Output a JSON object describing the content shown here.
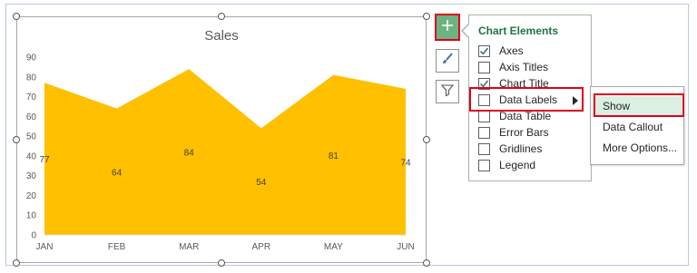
{
  "chart_data": {
    "type": "area",
    "title": "Sales",
    "categories": [
      "JAN",
      "FEB",
      "MAR",
      "APR",
      "MAY",
      "JUN"
    ],
    "values": [
      77,
      64,
      84,
      54,
      81,
      74
    ],
    "data_labels": [
      "77",
      "64",
      "84",
      "54",
      "81",
      "74"
    ],
    "ylim": [
      0,
      90
    ],
    "y_ticks": [
      "0",
      "10",
      "20",
      "30",
      "40",
      "50",
      "60",
      "70",
      "80",
      "90"
    ],
    "grid": false,
    "legend": "none",
    "fill_color": "#ffc000"
  },
  "side_buttons": {
    "chart_elements": {
      "icon": "plus-icon"
    },
    "chart_styles": {
      "icon": "paintbrush-icon"
    },
    "chart_filters": {
      "icon": "filter-icon"
    }
  },
  "chart_elements_panel": {
    "header": "Chart Elements",
    "items": [
      {
        "label": "Axes",
        "checked": true
      },
      {
        "label": "Axis Titles",
        "checked": false
      },
      {
        "label": "Chart Title",
        "checked": true
      },
      {
        "label": "Data Labels",
        "checked": false,
        "has_submenu": true
      },
      {
        "label": "Data Table",
        "checked": false
      },
      {
        "label": "Error Bars",
        "checked": false
      },
      {
        "label": "Gridlines",
        "checked": false
      },
      {
        "label": "Legend",
        "checked": false
      }
    ]
  },
  "data_labels_submenu": {
    "items": [
      {
        "label": "Show",
        "active": true
      },
      {
        "label": "Data Callout",
        "active": false
      },
      {
        "label": "More Options...",
        "active": false
      }
    ]
  },
  "colors": {
    "accent_green": "#217346",
    "highlight_red": "#e0001b",
    "selected_bg": "#dcefe3"
  }
}
